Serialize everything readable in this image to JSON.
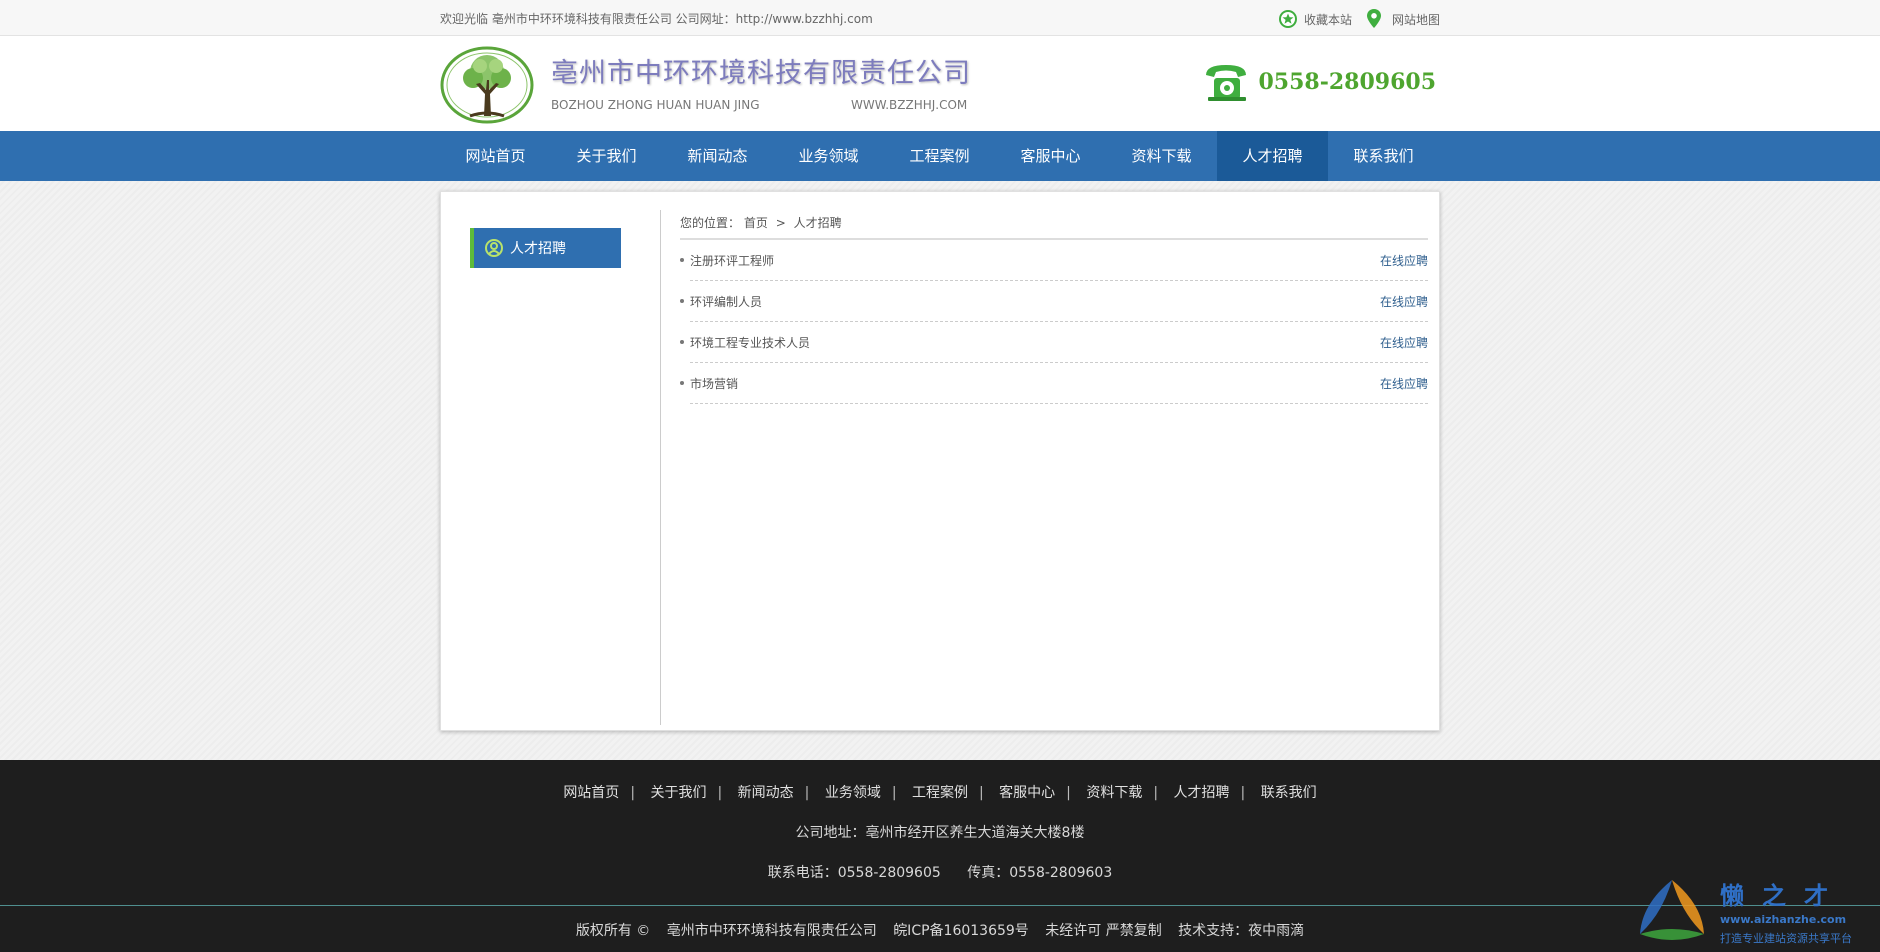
{
  "topbar": {
    "welcome": "欢迎光临 亳州市中环环境科技有限责任公司 公司网址：http://www.bzzhhj.com",
    "favorite_label": "收藏本站",
    "sitemap_label": "网站地图",
    "favorite_icon": "star-icon",
    "sitemap_icon": "location-pin-icon"
  },
  "header": {
    "company_name": "亳州市中环环境科技有限责任公司",
    "company_en": "BOZHOU ZHONG HUAN HUAN JING",
    "company_web": "WWW.BZZHHJ.COM",
    "phone": "0558-2809605",
    "phone_icon": "telephone-icon",
    "logo_icon": "tree-logo-icon",
    "accent_color": "#4ea52f"
  },
  "nav": {
    "items": [
      {
        "label": "网站首页"
      },
      {
        "label": "关于我们"
      },
      {
        "label": "新闻动态"
      },
      {
        "label": "业务领域"
      },
      {
        "label": "工程案例"
      },
      {
        "label": "客服中心"
      },
      {
        "label": "资料下载"
      },
      {
        "label": "人才招聘"
      },
      {
        "label": "联系我们"
      }
    ],
    "active_index": 7,
    "bg_color": "#2f6fb0"
  },
  "sidebar": {
    "title": "人才招聘",
    "icon": "recruit-icon"
  },
  "breadcrumb": {
    "prefix": "您的位置：",
    "home": "首页",
    "separator": ">",
    "current": "人才招聘"
  },
  "jobs": [
    {
      "title": "注册环评工程师",
      "action": "在线应聘"
    },
    {
      "title": "环评编制人员",
      "action": "在线应聘"
    },
    {
      "title": "环境工程专业技术人员",
      "action": "在线应聘"
    },
    {
      "title": "市场营销",
      "action": "在线应聘"
    }
  ],
  "footer": {
    "links": [
      "网站首页",
      "关于我们",
      "新闻动态",
      "业务领域",
      "工程案例",
      "客服中心",
      "资料下载",
      "人才招聘",
      "联系我们"
    ],
    "separator": "|",
    "address": "公司地址：亳州市经开区养生大道海关大楼8楼",
    "tel": "联系电话：0558-2809605",
    "fax": "传真：0558-2809603",
    "copyright": "版权所有 ©",
    "company": "亳州市中环环境科技有限责任公司",
    "icp": "皖ICP备16013659号",
    "notice": "未经许可 严禁复制",
    "support": "技术支持：夜中雨滴"
  },
  "watermark": {
    "title": "懒之才",
    "url": "www.aizhanzhe.com",
    "slogan": "打造专业建站资源共享平台"
  }
}
